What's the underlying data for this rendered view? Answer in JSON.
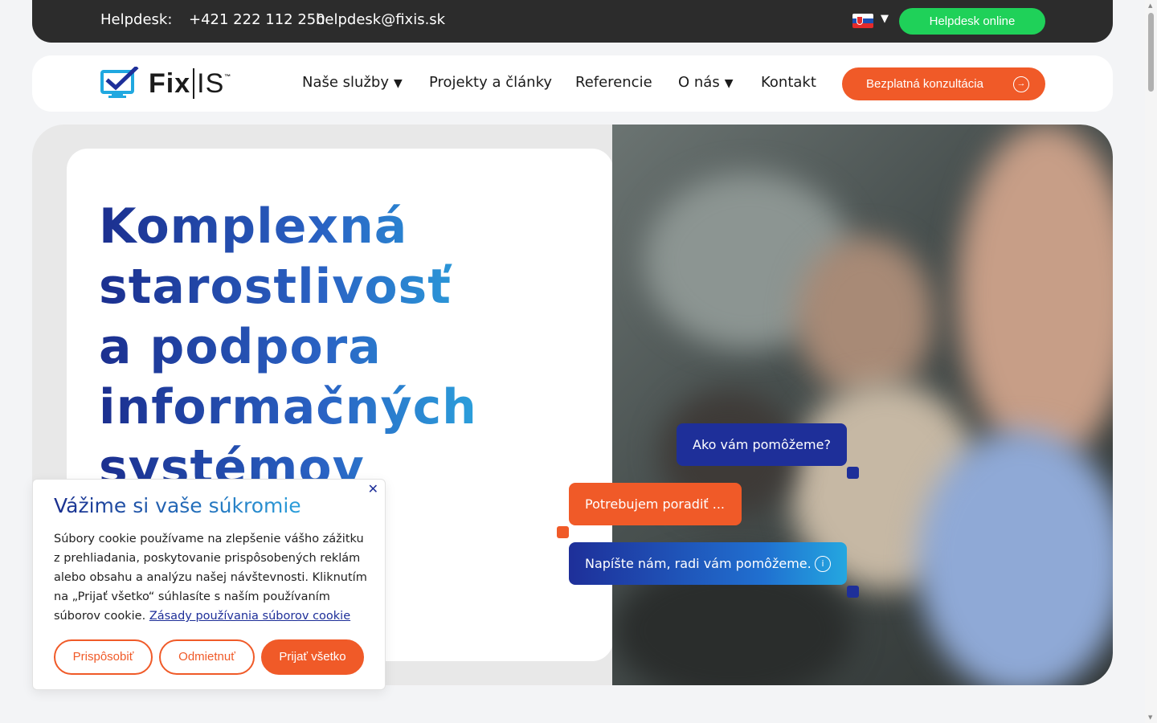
{
  "topbar": {
    "helpdesk_label": "Helpdesk:",
    "phone": "+421 222 112 250",
    "email": "helpdesk@fixis.sk",
    "lang_caret": "▼",
    "online_button": "Helpdesk online"
  },
  "nav": {
    "logo_text_bold": "Fix",
    "logo_text_light": "IS",
    "logo_tm": "™",
    "items": [
      {
        "label": "Naše služby",
        "caret": "▼"
      },
      {
        "label": "Projekty a články"
      },
      {
        "label": "Referencie"
      },
      {
        "label": "O nás",
        "caret": "▼"
      },
      {
        "label": "Kontakt"
      }
    ],
    "cta": "Bezplatná konzultácia",
    "cta_icon": "→"
  },
  "hero": {
    "title": "Komplexná starostlivosť a podpora informačných systémov"
  },
  "chat": {
    "bubble1": "Ako vám pomôžeme?",
    "bubble2": "Potrebujem poradiť ...",
    "bubble3": "Napíšte nám, radi vám pomôžeme.",
    "info_icon": "i"
  },
  "cookie": {
    "close": "✕",
    "title": "Vážime si vaše súkromie",
    "text": "Súbory cookie používame na zlepšenie vášho zážitku z prehliadania, poskytovanie prispôsobených reklám alebo obsahu a analýzu našej návštevnosti. Kliknutím na „Prijať všetko“ súhlasíte s naším používaním súborov cookie.",
    "link": "Zásady používania súborov cookie",
    "buttons": {
      "customize": "Prispôsobiť",
      "reject": "Odmietnuť",
      "accept": "Prijať všetko"
    }
  },
  "colors": {
    "accent_orange": "#f05a28",
    "accent_blue": "#1e2f99",
    "online_green": "#1fd159"
  }
}
